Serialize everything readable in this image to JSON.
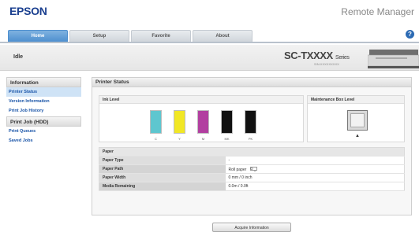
{
  "header": {
    "brand": "EPSON",
    "app_title": "Remote Manager"
  },
  "tabs": [
    {
      "label": "Home",
      "active": true
    },
    {
      "label": "Setup",
      "active": false
    },
    {
      "label": "Favorite",
      "active": false
    },
    {
      "label": "About",
      "active": false
    }
  ],
  "status": {
    "state": "Idle",
    "model": "SC-TXXXX",
    "model_suffix": "Series",
    "serial": "S/N:XXXXXXXXX"
  },
  "sidebar": {
    "sections": [
      {
        "title": "Information",
        "items": [
          "Printer Status",
          "Version Information",
          "Print Job History"
        ]
      },
      {
        "title": "Print Job (HDD)",
        "items": [
          "Print Queues",
          "Saved Jobs"
        ]
      }
    ]
  },
  "main": {
    "title": "Printer Status",
    "ink_panel_title": "Ink Level",
    "inks": [
      {
        "label": "C",
        "color": "#5ec6cf"
      },
      {
        "label": "Y",
        "color": "#f1e725"
      },
      {
        "label": "M",
        "color": "#b23fa0"
      },
      {
        "label": "MK",
        "color": "#111111"
      },
      {
        "label": "PK",
        "color": "#111111"
      }
    ],
    "maintenance_title": "Maintenance Box Level",
    "paper": {
      "header": "Paper",
      "rows": [
        {
          "label": "Paper Type",
          "value": "-"
        },
        {
          "label": "Paper Path",
          "value": "Roll paper"
        },
        {
          "label": "Paper Width",
          "value": "0 mm / 0 inch"
        },
        {
          "label": "Media Remaining",
          "value": "0.0m / 0.0ft"
        }
      ]
    },
    "acquire_button": "Acquire Information"
  }
}
